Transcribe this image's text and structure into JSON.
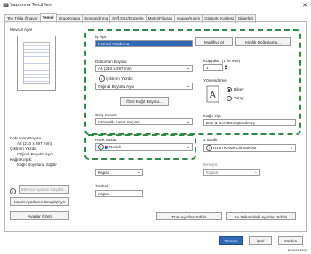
{
  "window": {
    "title": "Yazdırma Tercihleri"
  },
  "tabs": [
    "Tek Tıkla Önayar",
    "Temel",
    "Grup/Kopya",
    "Sonlandırma",
    "Sy/f.Düz/Düzenle",
    "Metin/Filigran",
    "Kapak/Kısım",
    "Görüntü Kalitesi",
    "Diğerleri"
  ],
  "preview": {
    "label": "Mevcut Ayar"
  },
  "docsize": {
    "label": "Dokuman Boyutu:",
    "value": "A4 (210 x 297 mm)",
    "out_label": "Çıktının Yazdır:",
    "out_value": "Orijinal Boyutla Aynı",
    "feed_label": "Kağıt/Kırpık:",
    "feed_value": "Kağıt Boyutuna Sığdır"
  },
  "leftbtns": {
    "refresh": "Mevcut Ayarları Kaydet...",
    "restore": "Kaset Ayarlarını Onayla/Ayn",
    "defaults": "Ayarlar Özeti"
  },
  "job": {
    "label": "İş Tipi:",
    "value": "Normal Yazdırma",
    "edit": "Modifiye et",
    "auth": "Kimlik Doğrulama..."
  },
  "doc": {
    "size_label": "Doküman Boyutu:",
    "size_value": "A4 (210 x 297 mm)",
    "print_label": "Çıktının Yazdır:",
    "print_value": "Orijinal Boyutta Aynı",
    "custom_btn": "Özel Kağıt Boyutu..."
  },
  "copies": {
    "label": "Kopyalar: (1 ile 999)",
    "value": "1"
  },
  "orientation": {
    "label": "Yönlendirme:",
    "portrait": "Dikey",
    "landscape": "Yatay"
  },
  "tray": {
    "label": "Giriş Kaseti:",
    "value": "Otomatik Kaset Seçimi",
    "paper_label": "Kağıt Tipi:",
    "paper_value": "Düz & Geri Dönüştürülmüş"
  },
  "color": {
    "label": "Renk Modu:",
    "value": "Renkli",
    "duplex_label": "2 taraflı:",
    "duplex_value": "Uzun Kenar Cilt Sol/Üst"
  },
  "combine": {
    "value": "Kapak",
    "label2": "Birleştir:",
    "value2": "Kapak",
    "staple_label": "Zımbalı:",
    "staple_value": "Kapak"
  },
  "bottom": {
    "reset_all": "Tüm Ayarları Sıfırla",
    "reset_tab": "Bu Sekmedeki Ayarları Sıfırla",
    "ok": "Tamam",
    "cancel": "İptal",
    "apply": "Yardım"
  },
  "footer": {
    "code": "DOC004543"
  },
  "colors": {
    "accent": "#2f68b4",
    "highlight": "#2e8a45"
  }
}
